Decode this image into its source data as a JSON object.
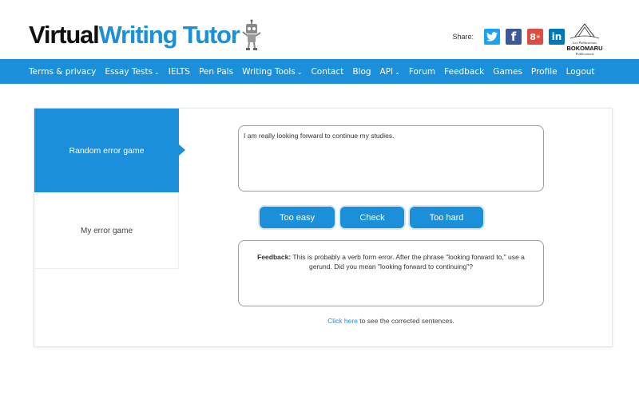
{
  "header": {
    "logo_part1": "Virtual ",
    "logo_part2": "Writing Tutor",
    "share_label": "Share:",
    "social": [
      "twitter-icon",
      "facebook-icon",
      "google-plus-icon",
      "linkedin-icon"
    ],
    "publisher_logo_text": [
      "Les Publications",
      "BOKOMARU",
      "Publications"
    ]
  },
  "nav": {
    "items": [
      {
        "label": "Terms & privacy",
        "dropdown": false
      },
      {
        "label": "Essay Tests",
        "dropdown": true
      },
      {
        "label": "IELTS",
        "dropdown": false
      },
      {
        "label": "Pen Pals",
        "dropdown": false
      },
      {
        "label": "Writing Tools",
        "dropdown": true
      },
      {
        "label": "Contact",
        "dropdown": false
      },
      {
        "label": "Blog",
        "dropdown": false
      },
      {
        "label": "API",
        "dropdown": true
      },
      {
        "label": "Forum",
        "dropdown": false
      },
      {
        "label": "Feedback",
        "dropdown": false
      },
      {
        "label": "Games",
        "dropdown": false
      },
      {
        "label": "Profile",
        "dropdown": false
      },
      {
        "label": "Logout",
        "dropdown": false
      }
    ],
    "caret": "⌄"
  },
  "sidebar": {
    "active": "Random error game",
    "other": "My error game"
  },
  "game": {
    "sentence": "I am really looking forward to continue my studies.",
    "buttons": {
      "easy": "Too easy",
      "check": "Check",
      "hard": "Too hard"
    },
    "feedback_label": "Feedback:",
    "feedback_text": " This is probably a verb form error. After the phrase \"looking forward to,\" use a gerund. Did you mean \"looking forward to continuing\"?",
    "click_link": "Click here",
    "click_rest": " to see the corrected sentences."
  },
  "colors": {
    "brand_blue": "#1b8fd9"
  }
}
